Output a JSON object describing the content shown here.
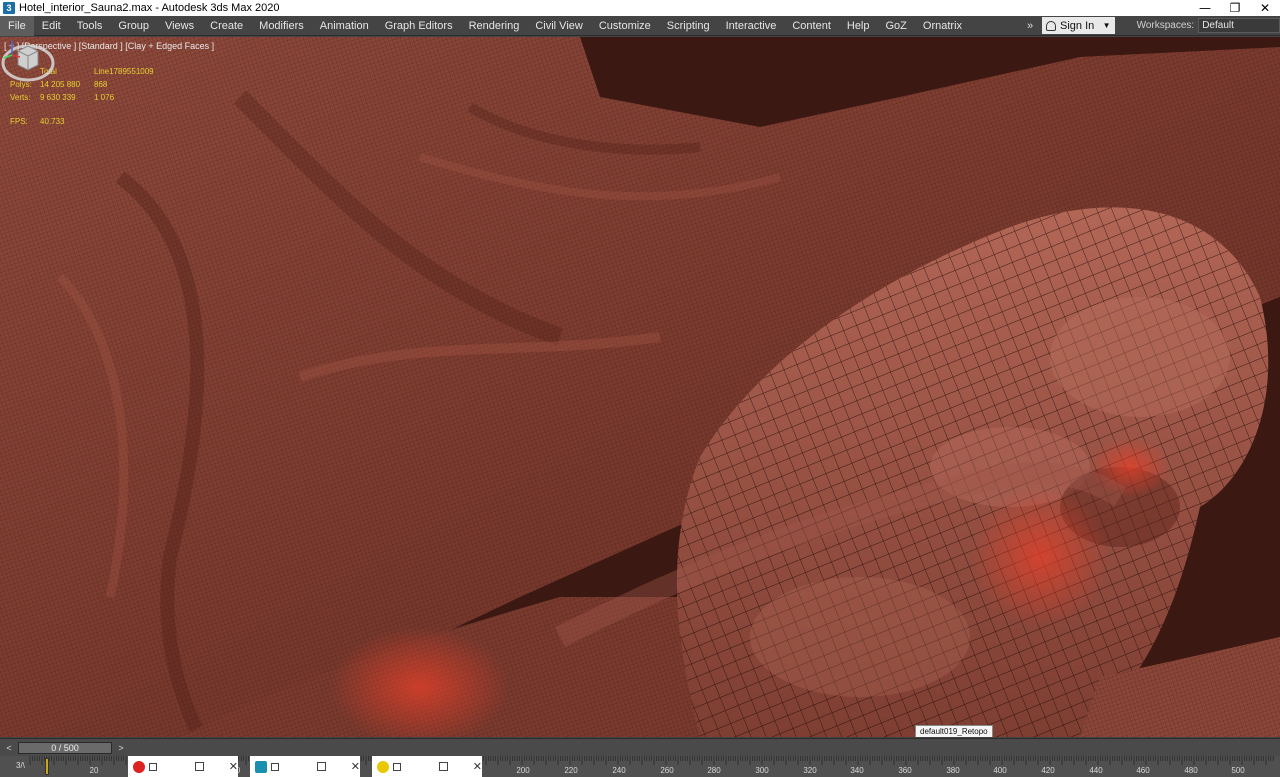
{
  "window": {
    "title": "Hotel_interior_Sauna2.max - Autodesk 3ds Max 2020",
    "controls": [
      "—",
      "❐",
      "✕"
    ]
  },
  "menu": {
    "items": [
      "File",
      "Edit",
      "Tools",
      "Group",
      "Views",
      "Create",
      "Modifiers",
      "Animation",
      "Graph Editors",
      "Rendering",
      "Civil View",
      "Customize",
      "Scripting",
      "Interactive",
      "Content",
      "Help",
      "GoZ",
      "Ornatrix"
    ],
    "more": "»",
    "sign_in": "Sign In",
    "workspaces_label": "Workspaces:",
    "workspace_value": "Default"
  },
  "viewport": {
    "label": "[ + ] [Perspective ] [Standard ] [Clay + Edged Faces ]",
    "stats": {
      "header": [
        "",
        "Total",
        "Line1789551009"
      ],
      "polys": [
        "Polys:",
        "14 205 880",
        "868"
      ],
      "verts": [
        "Verts:",
        "9 630 339",
        "1 076"
      ],
      "fps": [
        "FPS:",
        "40.733",
        ""
      ]
    },
    "tooltip": "default019_Retopo",
    "colors": {
      "background": "#3b1812",
      "cloth": "#8a4638",
      "cloth_light": "#a85a48",
      "wire": "#2a0f0a",
      "highlight": "#d8402c"
    }
  },
  "timeslider": {
    "prev": "<",
    "next": ">",
    "position": "0 / 500"
  },
  "trackbar": {
    "ticks": [
      "0",
      "20",
      "200",
      "220",
      "240",
      "260",
      "280",
      "300",
      "320",
      "340",
      "360",
      "380",
      "400",
      "420",
      "440",
      "460",
      "480",
      "500"
    ]
  },
  "taskbar": {
    "apps": [
      {
        "icon": "record-icon",
        "color": "#d22"
      },
      {
        "icon": "3dsmax-icon",
        "color": "#1a8fb0"
      },
      {
        "icon": "smiley-icon",
        "color": "#e8c800"
      }
    ]
  }
}
